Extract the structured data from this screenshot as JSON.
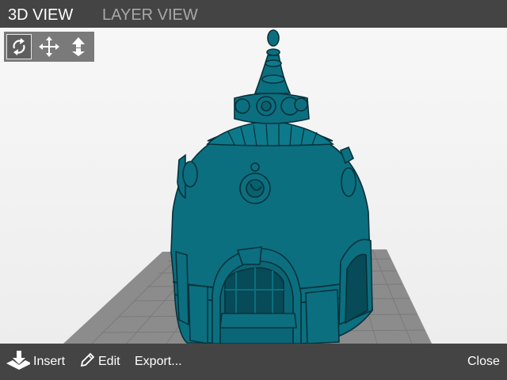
{
  "tabs": {
    "view3d": "3D VIEW",
    "layer": "LAYER VIEW"
  },
  "toolbox": {
    "tools": [
      {
        "name": "rotate",
        "icon": "rotate-icon",
        "selected": true
      },
      {
        "name": "move",
        "icon": "move-arrows-icon",
        "selected": false
      },
      {
        "name": "drop",
        "icon": "drop-to-bed-icon",
        "selected": false
      }
    ]
  },
  "bottom": {
    "insert_label": "Insert",
    "edit_label": "Edit",
    "export_label": "Export...",
    "close_label": "Close"
  },
  "colors": {
    "bar": "#444444",
    "model": "#0b6f80",
    "bed": "#8a8a8a",
    "inactive_tab": "#a8a8a8"
  }
}
